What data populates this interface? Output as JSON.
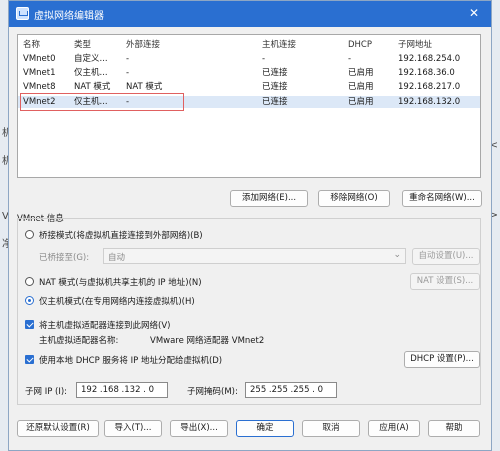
{
  "backdrop": {
    "left_chars": [
      "机",
      "机",
      "V",
      "净"
    ],
    "right_chars": [
      "<",
      ">"
    ]
  },
  "window": {
    "title": "虚拟网络编辑器",
    "close_glyph": "✕"
  },
  "table": {
    "headers": [
      "名称",
      "类型",
      "外部连接",
      "主机连接",
      "DHCP",
      "子网地址"
    ],
    "rows": [
      [
        "VMnet0",
        "自定义...",
        "-",
        "-",
        "-",
        "192.168.254.0"
      ],
      [
        "VMnet1",
        "仅主机...",
        "-",
        "已连接",
        "已启用",
        "192.168.36.0"
      ],
      [
        "VMnet8",
        "NAT 模式",
        "NAT 模式",
        "已连接",
        "已启用",
        "192.168.217.0"
      ],
      [
        "VMnet2",
        "仅主机...",
        "-",
        "已连接",
        "已启用",
        "192.168.132.0"
      ]
    ]
  },
  "net_buttons": {
    "add": "添加网络(E)...",
    "remove": "移除网络(O)",
    "rename": "重命名网络(W)..."
  },
  "info": {
    "group_title": "VMnet 信息",
    "bridged_label": "桥接模式(将虚拟机直接连接到外部网络)(B)",
    "bridged_to_label": "已桥接至(G):",
    "bridged_to_value": "自动",
    "auto_settings": "自动设置(U)...",
    "nat_label": "NAT 模式(与虚拟机共享主机的 IP 地址)(N)",
    "nat_settings": "NAT 设置(S)...",
    "hostonly_label": "仅主机模式(在专用网络内连接虚拟机)(H)",
    "connect_adapter_label": "将主机虚拟适配器连接到此网络(V)",
    "adapter_name_prefix": "主机虚拟适配器名称:",
    "adapter_name_value": "VMware 网络适配器 VMnet2",
    "dhcp_label": "使用本地 DHCP 服务将 IP 地址分配给虚拟机(D)",
    "dhcp_settings": "DHCP 设置(P)...",
    "subnet_ip_label": "子网 IP (I):",
    "subnet_ip_value": "192 .168 .132 . 0",
    "subnet_mask_label": "子网掩码(M):",
    "subnet_mask_value": "255 .255 .255 . 0"
  },
  "footer": {
    "restore": "还原默认设置(R)",
    "import": "导入(T)...",
    "export": "导出(X)...",
    "ok": "确定",
    "cancel": "取消",
    "apply": "应用(A)",
    "help": "帮助"
  }
}
